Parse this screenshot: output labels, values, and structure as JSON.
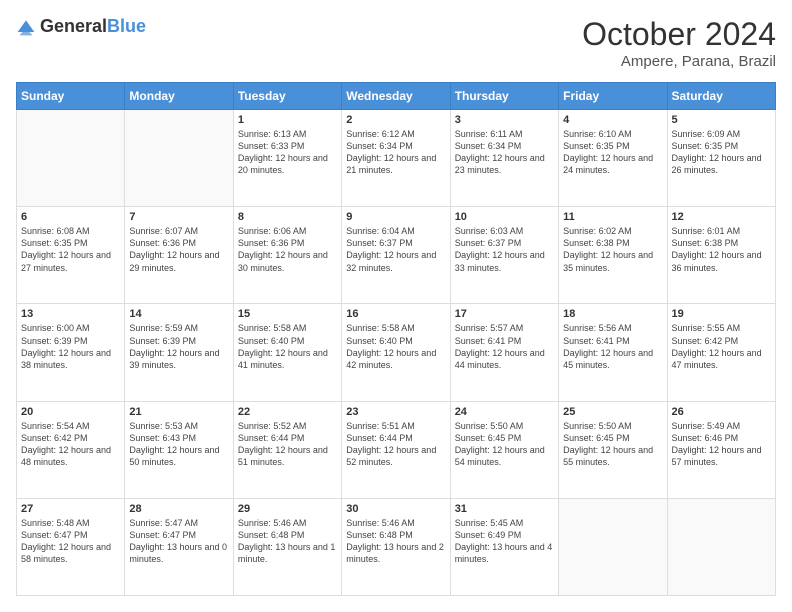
{
  "header": {
    "logo": {
      "general": "General",
      "blue": "Blue"
    },
    "title": "October 2024",
    "subtitle": "Ampere, Parana, Brazil"
  },
  "calendar": {
    "days_of_week": [
      "Sunday",
      "Monday",
      "Tuesday",
      "Wednesday",
      "Thursday",
      "Friday",
      "Saturday"
    ],
    "weeks": [
      [
        {
          "day": "",
          "info": ""
        },
        {
          "day": "",
          "info": ""
        },
        {
          "day": "1",
          "info": "Sunrise: 6:13 AM\nSunset: 6:33 PM\nDaylight: 12 hours and 20 minutes."
        },
        {
          "day": "2",
          "info": "Sunrise: 6:12 AM\nSunset: 6:34 PM\nDaylight: 12 hours and 21 minutes."
        },
        {
          "day": "3",
          "info": "Sunrise: 6:11 AM\nSunset: 6:34 PM\nDaylight: 12 hours and 23 minutes."
        },
        {
          "day": "4",
          "info": "Sunrise: 6:10 AM\nSunset: 6:35 PM\nDaylight: 12 hours and 24 minutes."
        },
        {
          "day": "5",
          "info": "Sunrise: 6:09 AM\nSunset: 6:35 PM\nDaylight: 12 hours and 26 minutes."
        }
      ],
      [
        {
          "day": "6",
          "info": "Sunrise: 6:08 AM\nSunset: 6:35 PM\nDaylight: 12 hours and 27 minutes."
        },
        {
          "day": "7",
          "info": "Sunrise: 6:07 AM\nSunset: 6:36 PM\nDaylight: 12 hours and 29 minutes."
        },
        {
          "day": "8",
          "info": "Sunrise: 6:06 AM\nSunset: 6:36 PM\nDaylight: 12 hours and 30 minutes."
        },
        {
          "day": "9",
          "info": "Sunrise: 6:04 AM\nSunset: 6:37 PM\nDaylight: 12 hours and 32 minutes."
        },
        {
          "day": "10",
          "info": "Sunrise: 6:03 AM\nSunset: 6:37 PM\nDaylight: 12 hours and 33 minutes."
        },
        {
          "day": "11",
          "info": "Sunrise: 6:02 AM\nSunset: 6:38 PM\nDaylight: 12 hours and 35 minutes."
        },
        {
          "day": "12",
          "info": "Sunrise: 6:01 AM\nSunset: 6:38 PM\nDaylight: 12 hours and 36 minutes."
        }
      ],
      [
        {
          "day": "13",
          "info": "Sunrise: 6:00 AM\nSunset: 6:39 PM\nDaylight: 12 hours and 38 minutes."
        },
        {
          "day": "14",
          "info": "Sunrise: 5:59 AM\nSunset: 6:39 PM\nDaylight: 12 hours and 39 minutes."
        },
        {
          "day": "15",
          "info": "Sunrise: 5:58 AM\nSunset: 6:40 PM\nDaylight: 12 hours and 41 minutes."
        },
        {
          "day": "16",
          "info": "Sunrise: 5:58 AM\nSunset: 6:40 PM\nDaylight: 12 hours and 42 minutes."
        },
        {
          "day": "17",
          "info": "Sunrise: 5:57 AM\nSunset: 6:41 PM\nDaylight: 12 hours and 44 minutes."
        },
        {
          "day": "18",
          "info": "Sunrise: 5:56 AM\nSunset: 6:41 PM\nDaylight: 12 hours and 45 minutes."
        },
        {
          "day": "19",
          "info": "Sunrise: 5:55 AM\nSunset: 6:42 PM\nDaylight: 12 hours and 47 minutes."
        }
      ],
      [
        {
          "day": "20",
          "info": "Sunrise: 5:54 AM\nSunset: 6:42 PM\nDaylight: 12 hours and 48 minutes."
        },
        {
          "day": "21",
          "info": "Sunrise: 5:53 AM\nSunset: 6:43 PM\nDaylight: 12 hours and 50 minutes."
        },
        {
          "day": "22",
          "info": "Sunrise: 5:52 AM\nSunset: 6:44 PM\nDaylight: 12 hours and 51 minutes."
        },
        {
          "day": "23",
          "info": "Sunrise: 5:51 AM\nSunset: 6:44 PM\nDaylight: 12 hours and 52 minutes."
        },
        {
          "day": "24",
          "info": "Sunrise: 5:50 AM\nSunset: 6:45 PM\nDaylight: 12 hours and 54 minutes."
        },
        {
          "day": "25",
          "info": "Sunrise: 5:50 AM\nSunset: 6:45 PM\nDaylight: 12 hours and 55 minutes."
        },
        {
          "day": "26",
          "info": "Sunrise: 5:49 AM\nSunset: 6:46 PM\nDaylight: 12 hours and 57 minutes."
        }
      ],
      [
        {
          "day": "27",
          "info": "Sunrise: 5:48 AM\nSunset: 6:47 PM\nDaylight: 12 hours and 58 minutes."
        },
        {
          "day": "28",
          "info": "Sunrise: 5:47 AM\nSunset: 6:47 PM\nDaylight: 13 hours and 0 minutes."
        },
        {
          "day": "29",
          "info": "Sunrise: 5:46 AM\nSunset: 6:48 PM\nDaylight: 13 hours and 1 minute."
        },
        {
          "day": "30",
          "info": "Sunrise: 5:46 AM\nSunset: 6:48 PM\nDaylight: 13 hours and 2 minutes."
        },
        {
          "day": "31",
          "info": "Sunrise: 5:45 AM\nSunset: 6:49 PM\nDaylight: 13 hours and 4 minutes."
        },
        {
          "day": "",
          "info": ""
        },
        {
          "day": "",
          "info": ""
        }
      ]
    ]
  }
}
